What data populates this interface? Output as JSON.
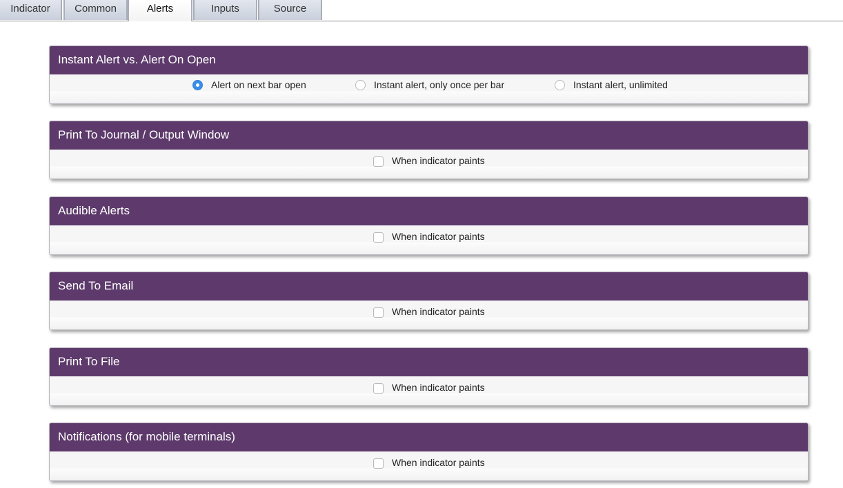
{
  "tabs": [
    {
      "label": "Indicator",
      "active": false
    },
    {
      "label": "Common",
      "active": false
    },
    {
      "label": "Alerts",
      "active": true
    },
    {
      "label": "Inputs",
      "active": false
    },
    {
      "label": "Source",
      "active": false
    }
  ],
  "colors": {
    "panel_header": "#5d3a6b",
    "radio_selected": "#3b8ee8"
  },
  "alert_mode": {
    "title": "Instant Alert vs. Alert On Open",
    "options": [
      {
        "label": "Alert on next bar open",
        "selected": true
      },
      {
        "label": "Instant alert, only once per bar",
        "selected": false
      },
      {
        "label": "Instant alert, unlimited",
        "selected": false
      }
    ]
  },
  "sections": [
    {
      "title": "Print To Journal / Output Window",
      "checkbox_label": "When indicator paints",
      "checked": false
    },
    {
      "title": "Audible Alerts",
      "checkbox_label": "When indicator paints",
      "checked": false
    },
    {
      "title": "Send To Email",
      "checkbox_label": "When indicator paints",
      "checked": false
    },
    {
      "title": "Print To File",
      "checkbox_label": "When indicator paints",
      "checked": false
    },
    {
      "title": "Notifications (for mobile terminals)",
      "checkbox_label": "When indicator paints",
      "checked": false
    }
  ]
}
